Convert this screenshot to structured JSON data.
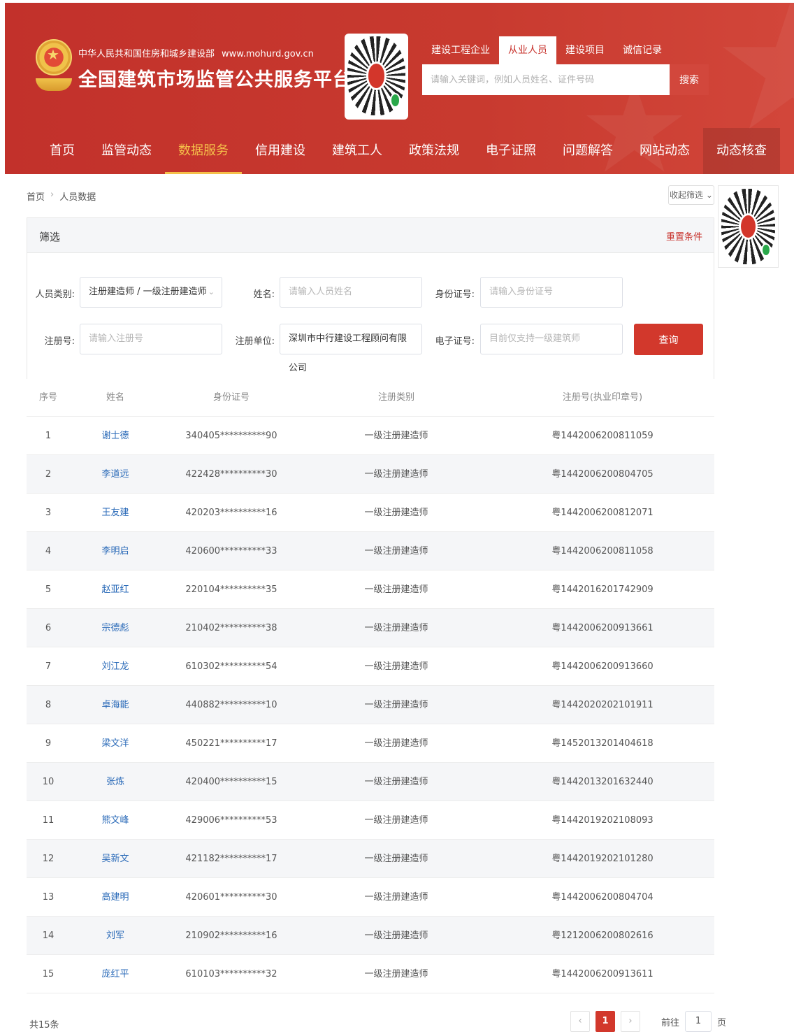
{
  "header": {
    "ministry": "中华人民共和国住房和城乡建设部",
    "url": "www.mohurd.gov.cn",
    "site_title": "全国建筑市场监管公共服务平台",
    "tabs": [
      {
        "label": "建设工程企业",
        "active": false
      },
      {
        "label": "从业人员",
        "active": true
      },
      {
        "label": "建设项目",
        "active": false
      },
      {
        "label": "诚信记录",
        "active": false
      }
    ],
    "search_placeholder": "请输入关键词，例如人员姓名、证件号码",
    "search_button": "搜索"
  },
  "nav": [
    "首页",
    "监管动态",
    "数据服务",
    "信用建设",
    "建筑工人",
    "政策法规",
    "电子证照",
    "问题解答",
    "网站动态",
    "动态核查"
  ],
  "nav_active": "数据服务",
  "breadcrumb": {
    "home": "首页",
    "current": "人员数据"
  },
  "collapse_label": "收起筛选",
  "filter": {
    "title": "筛选",
    "reset": "重置条件",
    "category_label": "人员类别:",
    "category_value": "注册建造师 / 一级注册建造师",
    "name_label": "姓名:",
    "name_placeholder": "请输入人员姓名",
    "id_label": "身份证号:",
    "id_placeholder": "请输入身份证号",
    "reg_label": "注册号:",
    "reg_placeholder": "请输入注册号",
    "unit_label": "注册单位:",
    "unit_value": "深圳市中行建设工程顾问有限公司",
    "ecert_label": "电子证号:",
    "ecert_placeholder": "目前仅支持一级建筑师",
    "query_button": "查询"
  },
  "table": {
    "headers": [
      "序号",
      "姓名",
      "身份证号",
      "注册类别",
      "注册号(执业印章号)"
    ],
    "rows": [
      [
        "1",
        "谢士德",
        "340405**********90",
        "一级注册建造师",
        "粤1442006200811059"
      ],
      [
        "2",
        "李道远",
        "422428**********30",
        "一级注册建造师",
        "粤1442006200804705"
      ],
      [
        "3",
        "王友建",
        "420203**********16",
        "一级注册建造师",
        "粤1442006200812071"
      ],
      [
        "4",
        "李明启",
        "420600**********33",
        "一级注册建造师",
        "粤1442006200811058"
      ],
      [
        "5",
        "赵亚红",
        "220104**********35",
        "一级注册建造师",
        "粤1442016201742909"
      ],
      [
        "6",
        "宗德彪",
        "210402**********38",
        "一级注册建造师",
        "粤1442006200913661"
      ],
      [
        "7",
        "刘江龙",
        "610302**********54",
        "一级注册建造师",
        "粤1442006200913660"
      ],
      [
        "8",
        "卓海能",
        "440882**********10",
        "一级注册建造师",
        "粤1442020202101911"
      ],
      [
        "9",
        "梁文洋",
        "450221**********17",
        "一级注册建造师",
        "粤1452013201404618"
      ],
      [
        "10",
        "张炼",
        "420400**********15",
        "一级注册建造师",
        "粤1442013201632440"
      ],
      [
        "11",
        "熊文峰",
        "429006**********53",
        "一级注册建造师",
        "粤1442019202108093"
      ],
      [
        "12",
        "吴新文",
        "421182**********17",
        "一级注册建造师",
        "粤1442019202101280"
      ],
      [
        "13",
        "高建明",
        "420601**********30",
        "一级注册建造师",
        "粤1442006200804704"
      ],
      [
        "14",
        "刘军",
        "210902**********16",
        "一级注册建造师",
        "粤1212006200802616"
      ],
      [
        "15",
        "庞红平",
        "610103**********32",
        "一级注册建造师",
        "粤1442006200913611"
      ]
    ]
  },
  "footer": {
    "total": "共15条",
    "prev": "‹",
    "page": "1",
    "next": "›",
    "goto_label": "前往",
    "goto_value": "1",
    "goto_suffix": "页"
  }
}
